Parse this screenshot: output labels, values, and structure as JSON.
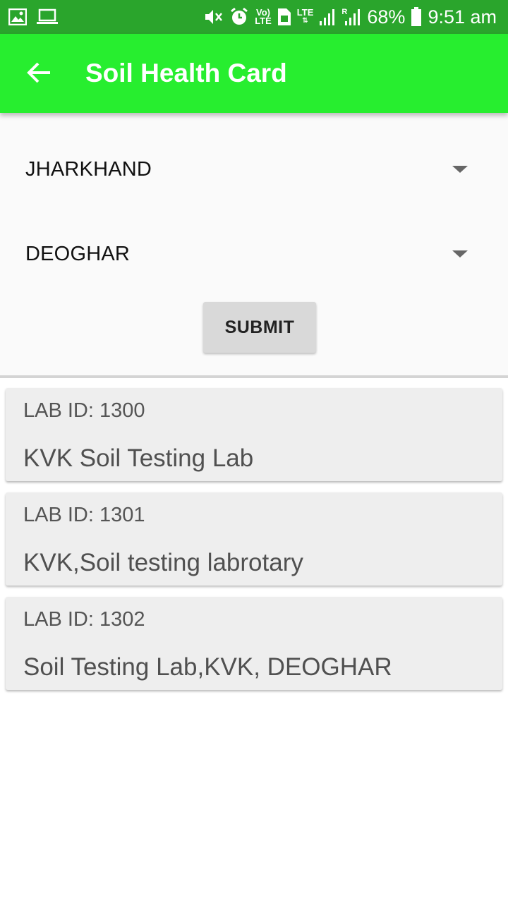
{
  "status_bar": {
    "battery": "68%",
    "time": "9:51 am",
    "volte_top": "Vo)",
    "volte_bottom": "LTE",
    "lte": "LTE",
    "roaming": "R",
    "left_icons": [
      "image-icon",
      "laptop-icon"
    ],
    "right_icons": [
      "mute-icon",
      "alarm-icon",
      "volte-icon",
      "sim-icon",
      "lte-icon",
      "signal-icon",
      "signal-roaming-icon",
      "battery-icon"
    ]
  },
  "app_bar": {
    "title": "Soil Health Card",
    "back_icon": "arrow-left-icon",
    "color": "#27ee2f"
  },
  "form": {
    "state_value": "JHARKHAND",
    "district_value": "DEOGHAR",
    "submit_label": "SUBMIT"
  },
  "labs": [
    {
      "id_label": "LAB ID: 1300",
      "name": "KVK Soil Testing Lab"
    },
    {
      "id_label": "LAB ID: 1301",
      "name": "KVK,Soil testing labrotary"
    },
    {
      "id_label": "LAB ID: 1302",
      "name": "Soil Testing Lab,KVK, DEOGHAR"
    }
  ],
  "colors": {
    "status_bar": "#2aa52c",
    "app_bar": "#27ee2f",
    "card_bg": "#eeeeee",
    "button_bg": "#d9d9d9"
  }
}
